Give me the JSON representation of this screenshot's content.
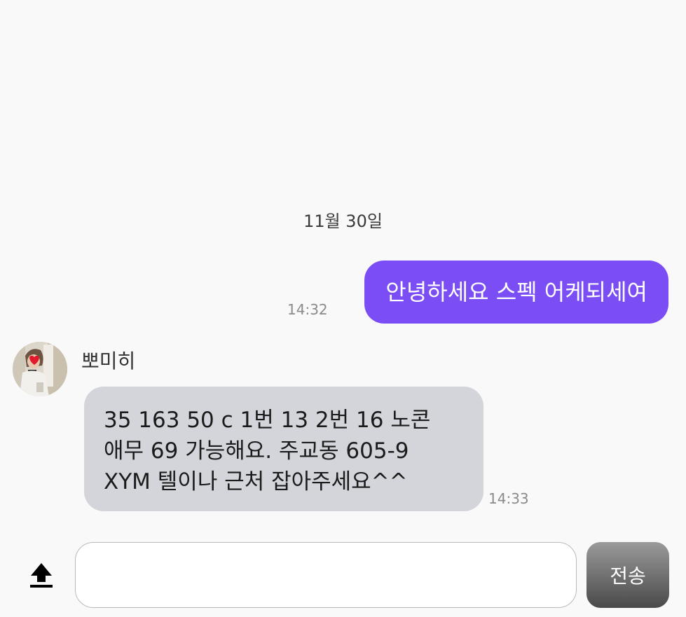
{
  "chat": {
    "date_separator": "11월 30일",
    "outgoing": {
      "text": "안녕하세요 스펙 어케되세여",
      "time": "14:32",
      "bubble_color": "#7b4ef5"
    },
    "incoming": {
      "sender": "뽀미히",
      "lines": [
        "35 163 50 c 1번 13 2번 16 노콘",
        "애무 69 가능해요. 주교동 605-9",
        "XYM 텔이나 근처 잡아주세요^^"
      ],
      "time": "14:33",
      "bubble_color": "#d3d5da"
    }
  },
  "composer": {
    "input_value": "",
    "upload_icon": "upload-arrow-icon",
    "send_label": "전송"
  }
}
